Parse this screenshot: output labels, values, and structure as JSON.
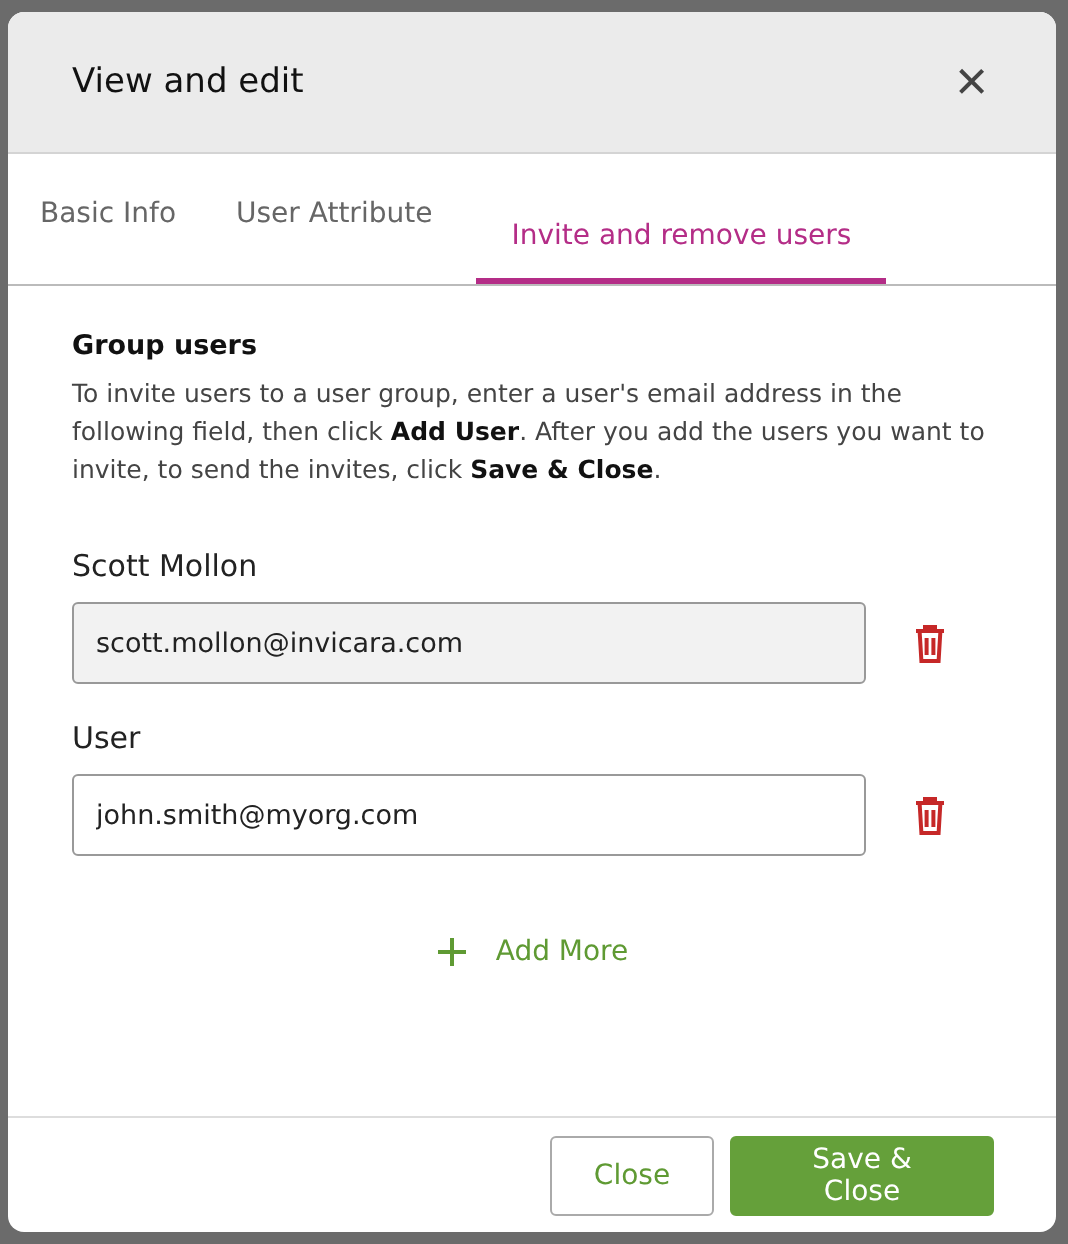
{
  "window": {
    "title": "View and edit",
    "close": "×"
  },
  "tabs": [
    {
      "label": "Basic Info",
      "selected": false
    },
    {
      "label": "User Attribute",
      "selected": false
    },
    {
      "label": "Invite and remove users",
      "selected": true
    }
  ],
  "section": {
    "title": "Group users",
    "text": "To invite users to a user group, enter a user's email address in the following field, then click **Add User**. After you add the users you want to invite, to send the invites, click **Save & Close**."
  },
  "users": [
    {
      "label": "Scott Mollon",
      "value": "scott.mollon@invicara.com",
      "disabled": true
    },
    {
      "label": "User",
      "value": "john.smith@myorg.com",
      "disabled": false
    }
  ],
  "add_more": "Add More",
  "buttons": [
    {
      "label": "Close",
      "kind": "secondary"
    },
    {
      "label": "Save & Close",
      "kind": "primary"
    }
  ]
}
